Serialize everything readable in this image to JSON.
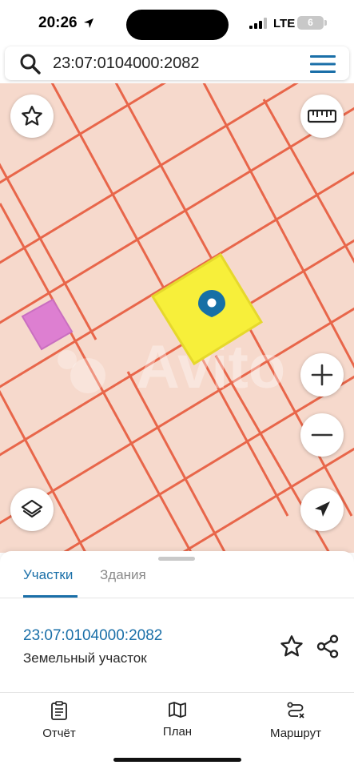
{
  "status_bar": {
    "time": "20:26",
    "network": "LTE",
    "battery": "6"
  },
  "search": {
    "value": "23:07:0104000:2082",
    "icon": "search-icon",
    "menu_icon": "hamburger-menu-icon"
  },
  "map": {
    "background_color": "#f6d9cc",
    "grid_line_color": "#e8664a",
    "selected_parcel_color": "#f7ef3a",
    "other_parcel_color": "#dd7fd1",
    "pin_color": "#1670a6",
    "watermark": "Avito",
    "controls": {
      "favorite_icon": "star-outline-icon",
      "ruler_icon": "ruler-icon",
      "zoom_in_icon": "plus-icon",
      "zoom_out_icon": "minus-icon",
      "layers_icon": "layers-icon",
      "locate_icon": "navigation-arrow-icon"
    }
  },
  "sheet": {
    "tabs": [
      {
        "label": "Участки",
        "active": true
      },
      {
        "label": "Здания",
        "active": false
      }
    ],
    "result": {
      "cadastral_number": "23:07:0104000:2082",
      "type": "Земельный участок"
    }
  },
  "bottom_nav": {
    "items": [
      {
        "label": "Отчёт",
        "icon": "clipboard-icon"
      },
      {
        "label": "План",
        "icon": "map-icon"
      },
      {
        "label": "Маршрут",
        "icon": "route-icon"
      }
    ]
  },
  "accent_color": "#1a6fa8"
}
